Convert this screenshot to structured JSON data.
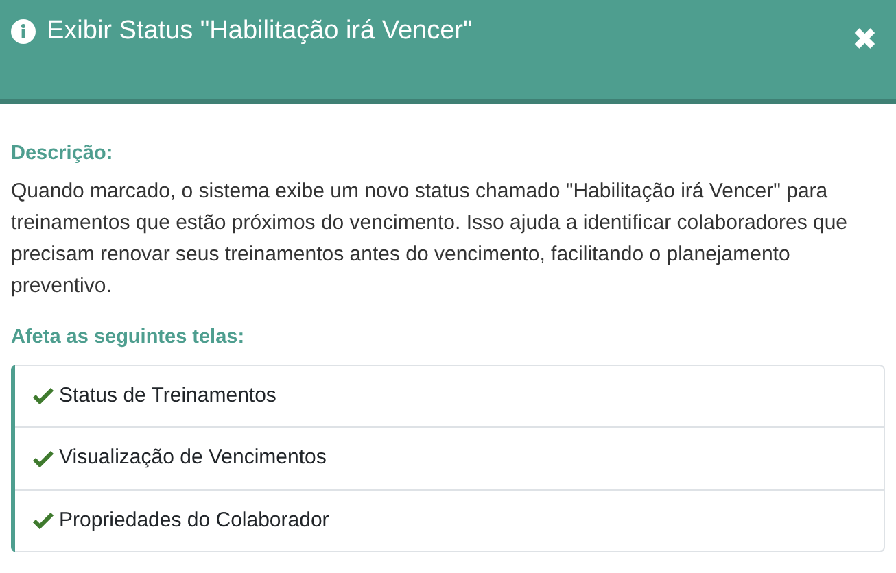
{
  "dialog": {
    "title": "Exibir Status \"Habilitação irá Vencer\"",
    "close": "✖"
  },
  "description": {
    "label": "Descrição:",
    "text": "Quando marcado, o sistema exibe um novo status chamado \"Habilitação irá Vencer\" para treinamentos que estão próximos do vencimento. Isso ajuda a identificar colaboradores que precisam renovar seus treinamentos antes do vencimento, facilitando o planejamento preventivo."
  },
  "affected": {
    "label": "Afeta as seguintes telas:",
    "items": [
      {
        "text": "Status de Treinamentos"
      },
      {
        "text": "Visualização de Vencimentos"
      },
      {
        "text": "Propriedades do Colaborador"
      }
    ]
  }
}
